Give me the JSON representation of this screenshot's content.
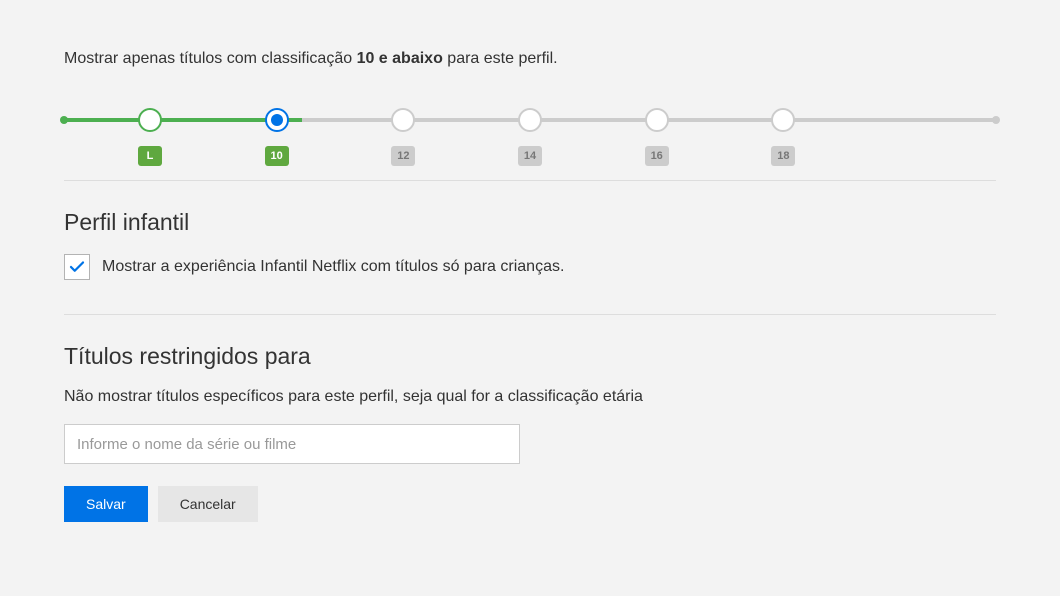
{
  "maturity": {
    "description_prefix": "Mostrar apenas títulos com classificação ",
    "description_bold": "10 e abaixo",
    "description_suffix": " para este perfil.",
    "levels": [
      "L",
      "10",
      "12",
      "14",
      "16",
      "18"
    ],
    "selected_index": 1
  },
  "kids_profile": {
    "title": "Perfil infantil",
    "checkbox_label": "Mostrar a experiência Infantil Netflix com títulos só para crianças.",
    "checked": true
  },
  "restricted": {
    "title": "Títulos restringidos para",
    "description": "Não mostrar títulos específicos para este perfil, seja qual for a classificação etária",
    "placeholder": "Informe o nome da série ou filme"
  },
  "buttons": {
    "save": "Salvar",
    "cancel": "Cancelar"
  }
}
